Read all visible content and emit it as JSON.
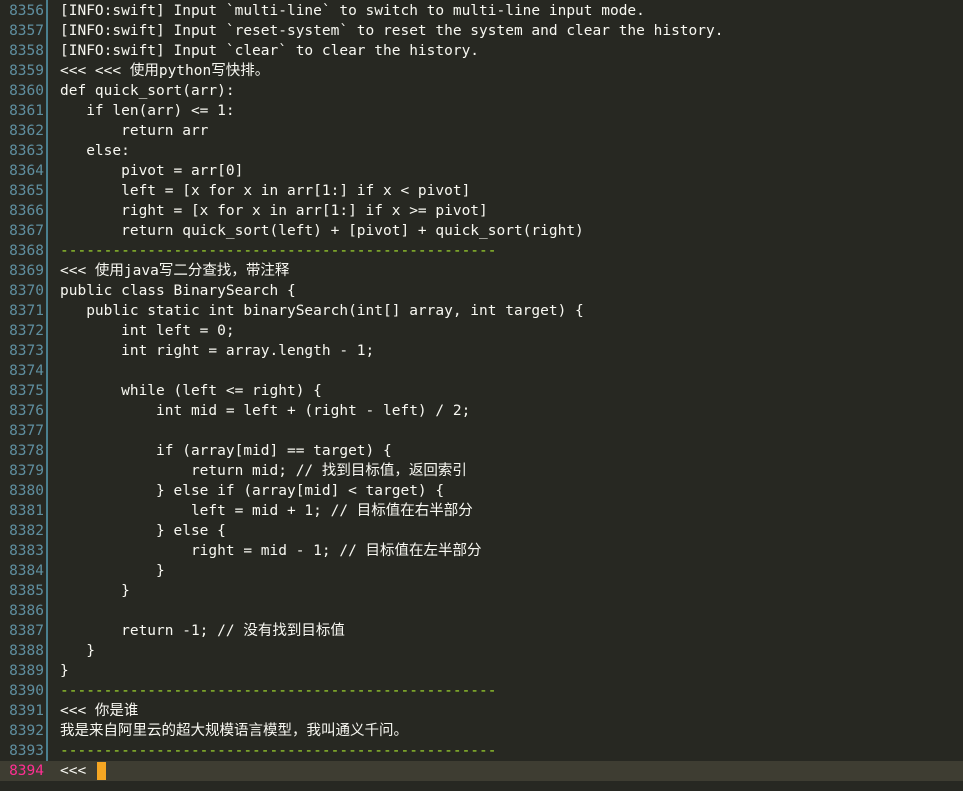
{
  "window": {
    "title": ""
  },
  "lines": [
    {
      "no": "8356",
      "text": "[INFO:swift] Input `multi-line` to switch to multi-line input mode.",
      "kind": "info"
    },
    {
      "no": "8357",
      "text": "[INFO:swift] Input `reset-system` to reset the system and clear the history.",
      "kind": "info"
    },
    {
      "no": "8358",
      "text": "[INFO:swift] Input `clear` to clear the history.",
      "kind": "info"
    },
    {
      "no": "8359",
      "text": "<<< <<< 使用python写快排。",
      "kind": "prompt"
    },
    {
      "no": "8360",
      "text": "def quick_sort(arr):",
      "kind": "code"
    },
    {
      "no": "8361",
      "text": "   if len(arr) <= 1:",
      "kind": "code"
    },
    {
      "no": "8362",
      "text": "       return arr",
      "kind": "code"
    },
    {
      "no": "8363",
      "text": "   else:",
      "kind": "code"
    },
    {
      "no": "8364",
      "text": "       pivot = arr[0]",
      "kind": "code"
    },
    {
      "no": "8365",
      "text": "       left = [x for x in arr[1:] if x < pivot]",
      "kind": "code"
    },
    {
      "no": "8366",
      "text": "       right = [x for x in arr[1:] if x >= pivot]",
      "kind": "code"
    },
    {
      "no": "8367",
      "text": "       return quick_sort(left) + [pivot] + quick_sort(right)",
      "kind": "code"
    },
    {
      "no": "8368",
      "text": "--------------------------------------------------",
      "kind": "dash"
    },
    {
      "no": "8369",
      "text": "<<< 使用java写二分查找，带注释",
      "kind": "prompt"
    },
    {
      "no": "8370",
      "text": "public class BinarySearch {",
      "kind": "code"
    },
    {
      "no": "8371",
      "text": "   public static int binarySearch(int[] array, int target) {",
      "kind": "code"
    },
    {
      "no": "8372",
      "text": "       int left = 0;",
      "kind": "code"
    },
    {
      "no": "8373",
      "text": "       int right = array.length - 1;",
      "kind": "code"
    },
    {
      "no": "8374",
      "text": "",
      "kind": "code"
    },
    {
      "no": "8375",
      "text": "       while (left <= right) {",
      "kind": "code"
    },
    {
      "no": "8376",
      "text": "           int mid = left + (right - left) / 2;",
      "kind": "code"
    },
    {
      "no": "8377",
      "text": "",
      "kind": "code"
    },
    {
      "no": "8378",
      "text": "           if (array[mid] == target) {",
      "kind": "code"
    },
    {
      "no": "8379",
      "text": "               return mid; // 找到目标值，返回索引",
      "kind": "code"
    },
    {
      "no": "8380",
      "text": "           } else if (array[mid] < target) {",
      "kind": "code"
    },
    {
      "no": "8381",
      "text": "               left = mid + 1; // 目标值在右半部分",
      "kind": "code"
    },
    {
      "no": "8382",
      "text": "           } else {",
      "kind": "code"
    },
    {
      "no": "8383",
      "text": "               right = mid - 1; // 目标值在左半部分",
      "kind": "code"
    },
    {
      "no": "8384",
      "text": "           }",
      "kind": "code"
    },
    {
      "no": "8385",
      "text": "       }",
      "kind": "code"
    },
    {
      "no": "8386",
      "text": "",
      "kind": "code"
    },
    {
      "no": "8387",
      "text": "       return -1; // 没有找到目标值",
      "kind": "code"
    },
    {
      "no": "8388",
      "text": "   }",
      "kind": "code"
    },
    {
      "no": "8389",
      "text": "}",
      "kind": "code"
    },
    {
      "no": "8390",
      "text": "--------------------------------------------------",
      "kind": "dash"
    },
    {
      "no": "8391",
      "text": "<<< 你是谁",
      "kind": "prompt"
    },
    {
      "no": "8392",
      "text": "我是来自阿里云的超大规模语言模型，我叫通义千问。",
      "kind": "code"
    },
    {
      "no": "8393",
      "text": "--------------------------------------------------",
      "kind": "dash"
    },
    {
      "no": "8394",
      "text": "<<< ",
      "kind": "input"
    }
  ],
  "colors": {
    "background": "#272822",
    "gutter_text": "#5f8fa0",
    "current_line_number": "#ff2f92",
    "cursor": "#f5a623",
    "info": "#7ab4f5",
    "prompt": "#a6e22e",
    "dash": "#a6e22e"
  }
}
